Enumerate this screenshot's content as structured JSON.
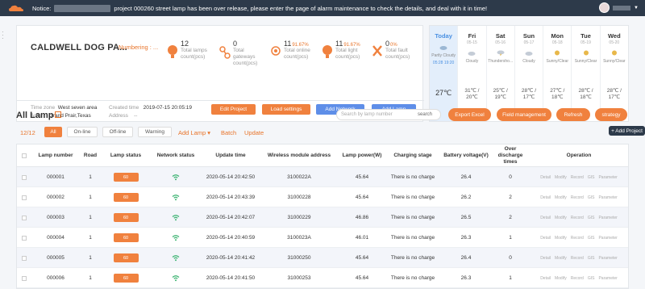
{
  "topbar": {
    "notice_prefix": "Notice:",
    "notice_text": "project 000260 street lamp has been over release, please enter the page of alarm maintenance to check the details, and deal with it in time!"
  },
  "project": {
    "name": "CALDWELL DOG PA...",
    "numbering_label": "Numbering : ...",
    "stats": [
      {
        "num": "12",
        "pct": "",
        "label1": "Total lamps",
        "label2": "count(pcs)"
      },
      {
        "num": "0",
        "pct": "",
        "label1": "Total",
        "label2": "gateways",
        "label3": "count(pcs)"
      },
      {
        "num": "11",
        "pct": "91.67%",
        "label1": "Total online",
        "label2": "count(pcs)"
      },
      {
        "num": "11",
        "pct": "91.67%",
        "label1": "Total light",
        "label2": "count(pcs)"
      },
      {
        "num": "0",
        "pct": "0%",
        "label1": "Total fault",
        "label2": "count(pcs)"
      }
    ],
    "time_zone_label": "Time zone",
    "time_zone_value": "West seven area",
    "area_label": "Area",
    "area_value": "Grand Prair,Texas",
    "created_label": "Created time",
    "created_value": "2019-07-15 20:05:19",
    "address_label": "Address",
    "address_value": "--",
    "buttons": {
      "edit": "Edit Project",
      "load": "Load settings",
      "add_network": "Add Network",
      "add_lamp": "Add Lamp"
    }
  },
  "weather": {
    "days": [
      {
        "name": "Today",
        "date": "",
        "cond": "Partly Cloudy",
        "temp": "27℃",
        "sunrise": "05:28",
        "sunset": "19:20"
      },
      {
        "name": "Fri",
        "date": "05-15",
        "cond": "Cloudy",
        "temp": "31℃ / 20℃"
      },
      {
        "name": "Sat",
        "date": "05-16",
        "cond": "Thundersho...",
        "temp": "25℃ / 19℃"
      },
      {
        "name": "Sun",
        "date": "05-17",
        "cond": "Cloudy",
        "temp": "28℃ / 17℃"
      },
      {
        "name": "Mon",
        "date": "05-18",
        "cond": "Sunny/Clear",
        "temp": "27℃ / 18℃"
      },
      {
        "name": "Tue",
        "date": "05-19",
        "cond": "Sunny/Clear",
        "temp": "28℃ / 18℃"
      },
      {
        "name": "Wed",
        "date": "05-20",
        "cond": "Sunny/Clear",
        "temp": "28℃ / 17℃"
      }
    ]
  },
  "lamps": {
    "title": "All Lamp",
    "search_placeholder": "Search by lamp number",
    "search_button": "search",
    "export": "Export Excel",
    "field_mgmt": "Field management",
    "refresh": "Refresh",
    "strategy": "strategy",
    "tooltip": "+ Add Project",
    "count": "12/12",
    "filters": [
      "All",
      "On-line",
      "Off-line",
      "Warning"
    ],
    "links": {
      "add_lamp": "Add Lamp ▾",
      "batch": "Batch",
      "update": "Update"
    },
    "columns": [
      "Lamp number",
      "Road",
      "Lamp status",
      "Network status",
      "Update time",
      "Wireless module address",
      "Lamp power(W)",
      "Charging stage",
      "Battery voltage(V)",
      "Over discharge times",
      "Operation"
    ],
    "ops": [
      "Detail",
      "Modify",
      "Record",
      "GIS",
      "Parameter"
    ],
    "rows": [
      {
        "num": "000001",
        "road": "1",
        "status": "60",
        "time": "2020-05-14 20:42:50",
        "addr": "3100022A",
        "power": "45.64",
        "charge": "There is no charge",
        "volt": "26.4",
        "over": "0"
      },
      {
        "num": "000002",
        "road": "1",
        "status": "60",
        "time": "2020-05-14 20:43:39",
        "addr": "31000228",
        "power": "45.64",
        "charge": "There is no charge",
        "volt": "26.2",
        "over": "2"
      },
      {
        "num": "000003",
        "road": "1",
        "status": "60",
        "time": "2020-05-14 20:42:07",
        "addr": "31000229",
        "power": "46.86",
        "charge": "There is no charge",
        "volt": "26.5",
        "over": "2"
      },
      {
        "num": "000004",
        "road": "1",
        "status": "60",
        "time": "2020-05-14 20:40:59",
        "addr": "3100023A",
        "power": "46.01",
        "charge": "There is no charge",
        "volt": "26.3",
        "over": "1"
      },
      {
        "num": "000005",
        "road": "1",
        "status": "60",
        "time": "2020-05-14 20:41:42",
        "addr": "31000250",
        "power": "45.64",
        "charge": "There is no charge",
        "volt": "26.4",
        "over": "0"
      },
      {
        "num": "000006",
        "road": "1",
        "status": "60",
        "time": "2020-05-14 20:41:50",
        "addr": "31000253",
        "power": "45.64",
        "charge": "There is no charge",
        "volt": "26.3",
        "over": "1"
      }
    ]
  },
  "colors": {
    "accent": "#f0813e",
    "blue": "#5e8ee8",
    "topbar": "#2d3a4a"
  }
}
